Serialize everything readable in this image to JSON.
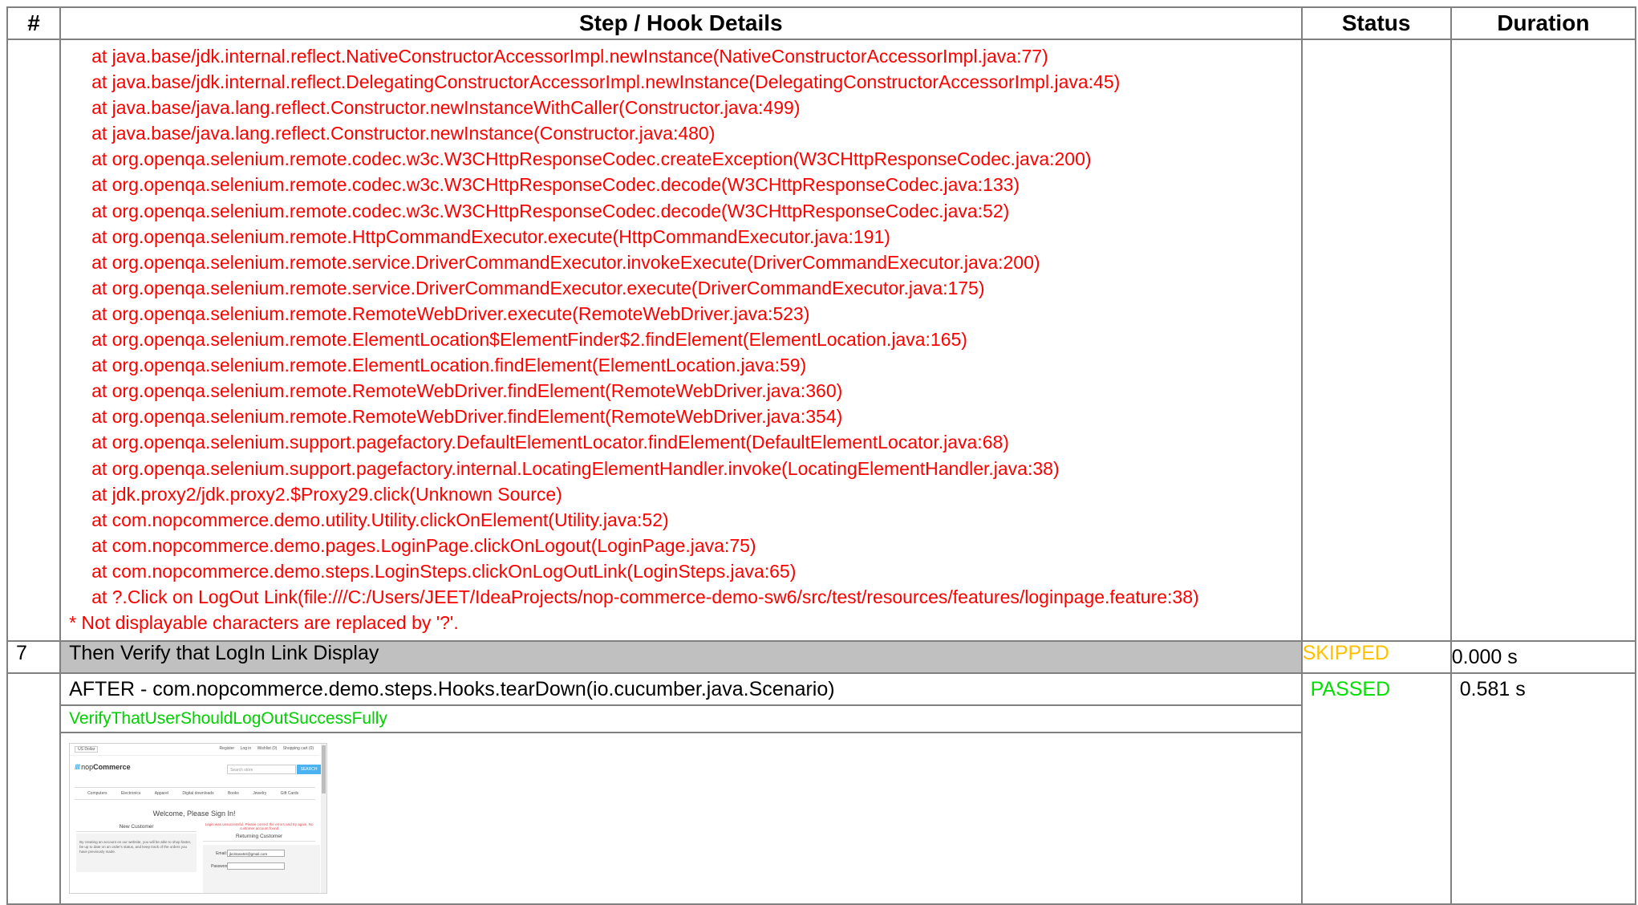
{
  "table": {
    "headers": {
      "num": "#",
      "step": "Step / Hook Details",
      "status": "Status",
      "duration": "Duration"
    }
  },
  "stacktrace": {
    "frames": [
      "at java.base/jdk.internal.reflect.NativeConstructorAccessorImpl.newInstance(NativeConstructorAccessorImpl.java:77)",
      "at java.base/jdk.internal.reflect.DelegatingConstructorAccessorImpl.newInstance(DelegatingConstructorAccessorImpl.java:45)",
      "at java.base/java.lang.reflect.Constructor.newInstanceWithCaller(Constructor.java:499)",
      "at java.base/java.lang.reflect.Constructor.newInstance(Constructor.java:480)",
      "at org.openqa.selenium.remote.codec.w3c.W3CHttpResponseCodec.createException(W3CHttpResponseCodec.java:200)",
      "at org.openqa.selenium.remote.codec.w3c.W3CHttpResponseCodec.decode(W3CHttpResponseCodec.java:133)",
      "at org.openqa.selenium.remote.codec.w3c.W3CHttpResponseCodec.decode(W3CHttpResponseCodec.java:52)",
      "at org.openqa.selenium.remote.HttpCommandExecutor.execute(HttpCommandExecutor.java:191)",
      "at org.openqa.selenium.remote.service.DriverCommandExecutor.invokeExecute(DriverCommandExecutor.java:200)",
      "at org.openqa.selenium.remote.service.DriverCommandExecutor.execute(DriverCommandExecutor.java:175)",
      "at org.openqa.selenium.remote.RemoteWebDriver.execute(RemoteWebDriver.java:523)",
      "at org.openqa.selenium.remote.ElementLocation$ElementFinder$2.findElement(ElementLocation.java:165)",
      "at org.openqa.selenium.remote.ElementLocation.findElement(ElementLocation.java:59)",
      "at org.openqa.selenium.remote.RemoteWebDriver.findElement(RemoteWebDriver.java:360)",
      "at org.openqa.selenium.remote.RemoteWebDriver.findElement(RemoteWebDriver.java:354)",
      "at org.openqa.selenium.support.pagefactory.DefaultElementLocator.findElement(DefaultElementLocator.java:68)",
      "at org.openqa.selenium.support.pagefactory.internal.LocatingElementHandler.invoke(LocatingElementHandler.java:38)",
      "at jdk.proxy2/jdk.proxy2.$Proxy29.click(Unknown Source)",
      "at com.nopcommerce.demo.utility.Utility.clickOnElement(Utility.java:52)",
      "at com.nopcommerce.demo.pages.LoginPage.clickOnLogout(LoginPage.java:75)",
      "at com.nopcommerce.demo.steps.LoginSteps.clickOnLogOutLink(LoginSteps.java:65)",
      "at ?.Click on LogOut Link(file:///C:/Users/JEET/IdeaProjects/nop-commerce-demo-sw6/src/test/resources/features/loginpage.feature:38)"
    ],
    "note": "* Not displayable characters are replaced by '?'."
  },
  "step7": {
    "number": "7",
    "text": "Then Verify that LogIn Link Display",
    "status": "SKIPPED",
    "duration": "0.000 s"
  },
  "hook": {
    "title": "AFTER - com.nopcommerce.demo.steps.Hooks.tearDown(io.cucumber.java.Scenario)",
    "subtitle": "VerifyThatUserShouldLogOutSuccessFully",
    "status": "PASSED",
    "duration": "0.581 s",
    "screenshot": {
      "currency": "US Dollar",
      "toplinks": [
        "Register",
        "Log in",
        "Wishlist (0)",
        "Shopping cart (0)"
      ],
      "logo_prefix": "nop",
      "logo_suffix": "Commerce",
      "search_placeholder": "Search store",
      "search_button": "SEARCH",
      "menu": [
        "Computers",
        "Electronics",
        "Apparel",
        "Digital downloads",
        "Books",
        "Jewelry",
        "Gift Cards"
      ],
      "welcome": "Welcome, Please Sign In!",
      "new_customer": "New Customer",
      "new_customer_text": "By creating an account on our website, you will be able to shop faster, be up to date on an order's status, and keep track of the orders you have previously made.",
      "error": "Login was unsuccessful. Please correct the errors and try again. No customer account found",
      "returning_customer": "Returning Customer",
      "email_label": "Email:",
      "email_value": "jkcitraneter@gmail.com",
      "password_label": "Password:"
    }
  },
  "colors": {
    "failed_text": "#ff0000",
    "skipped": "#ffc000",
    "passed": "#00e000",
    "border": "#808080",
    "step_bg": "#c0c0c0"
  }
}
